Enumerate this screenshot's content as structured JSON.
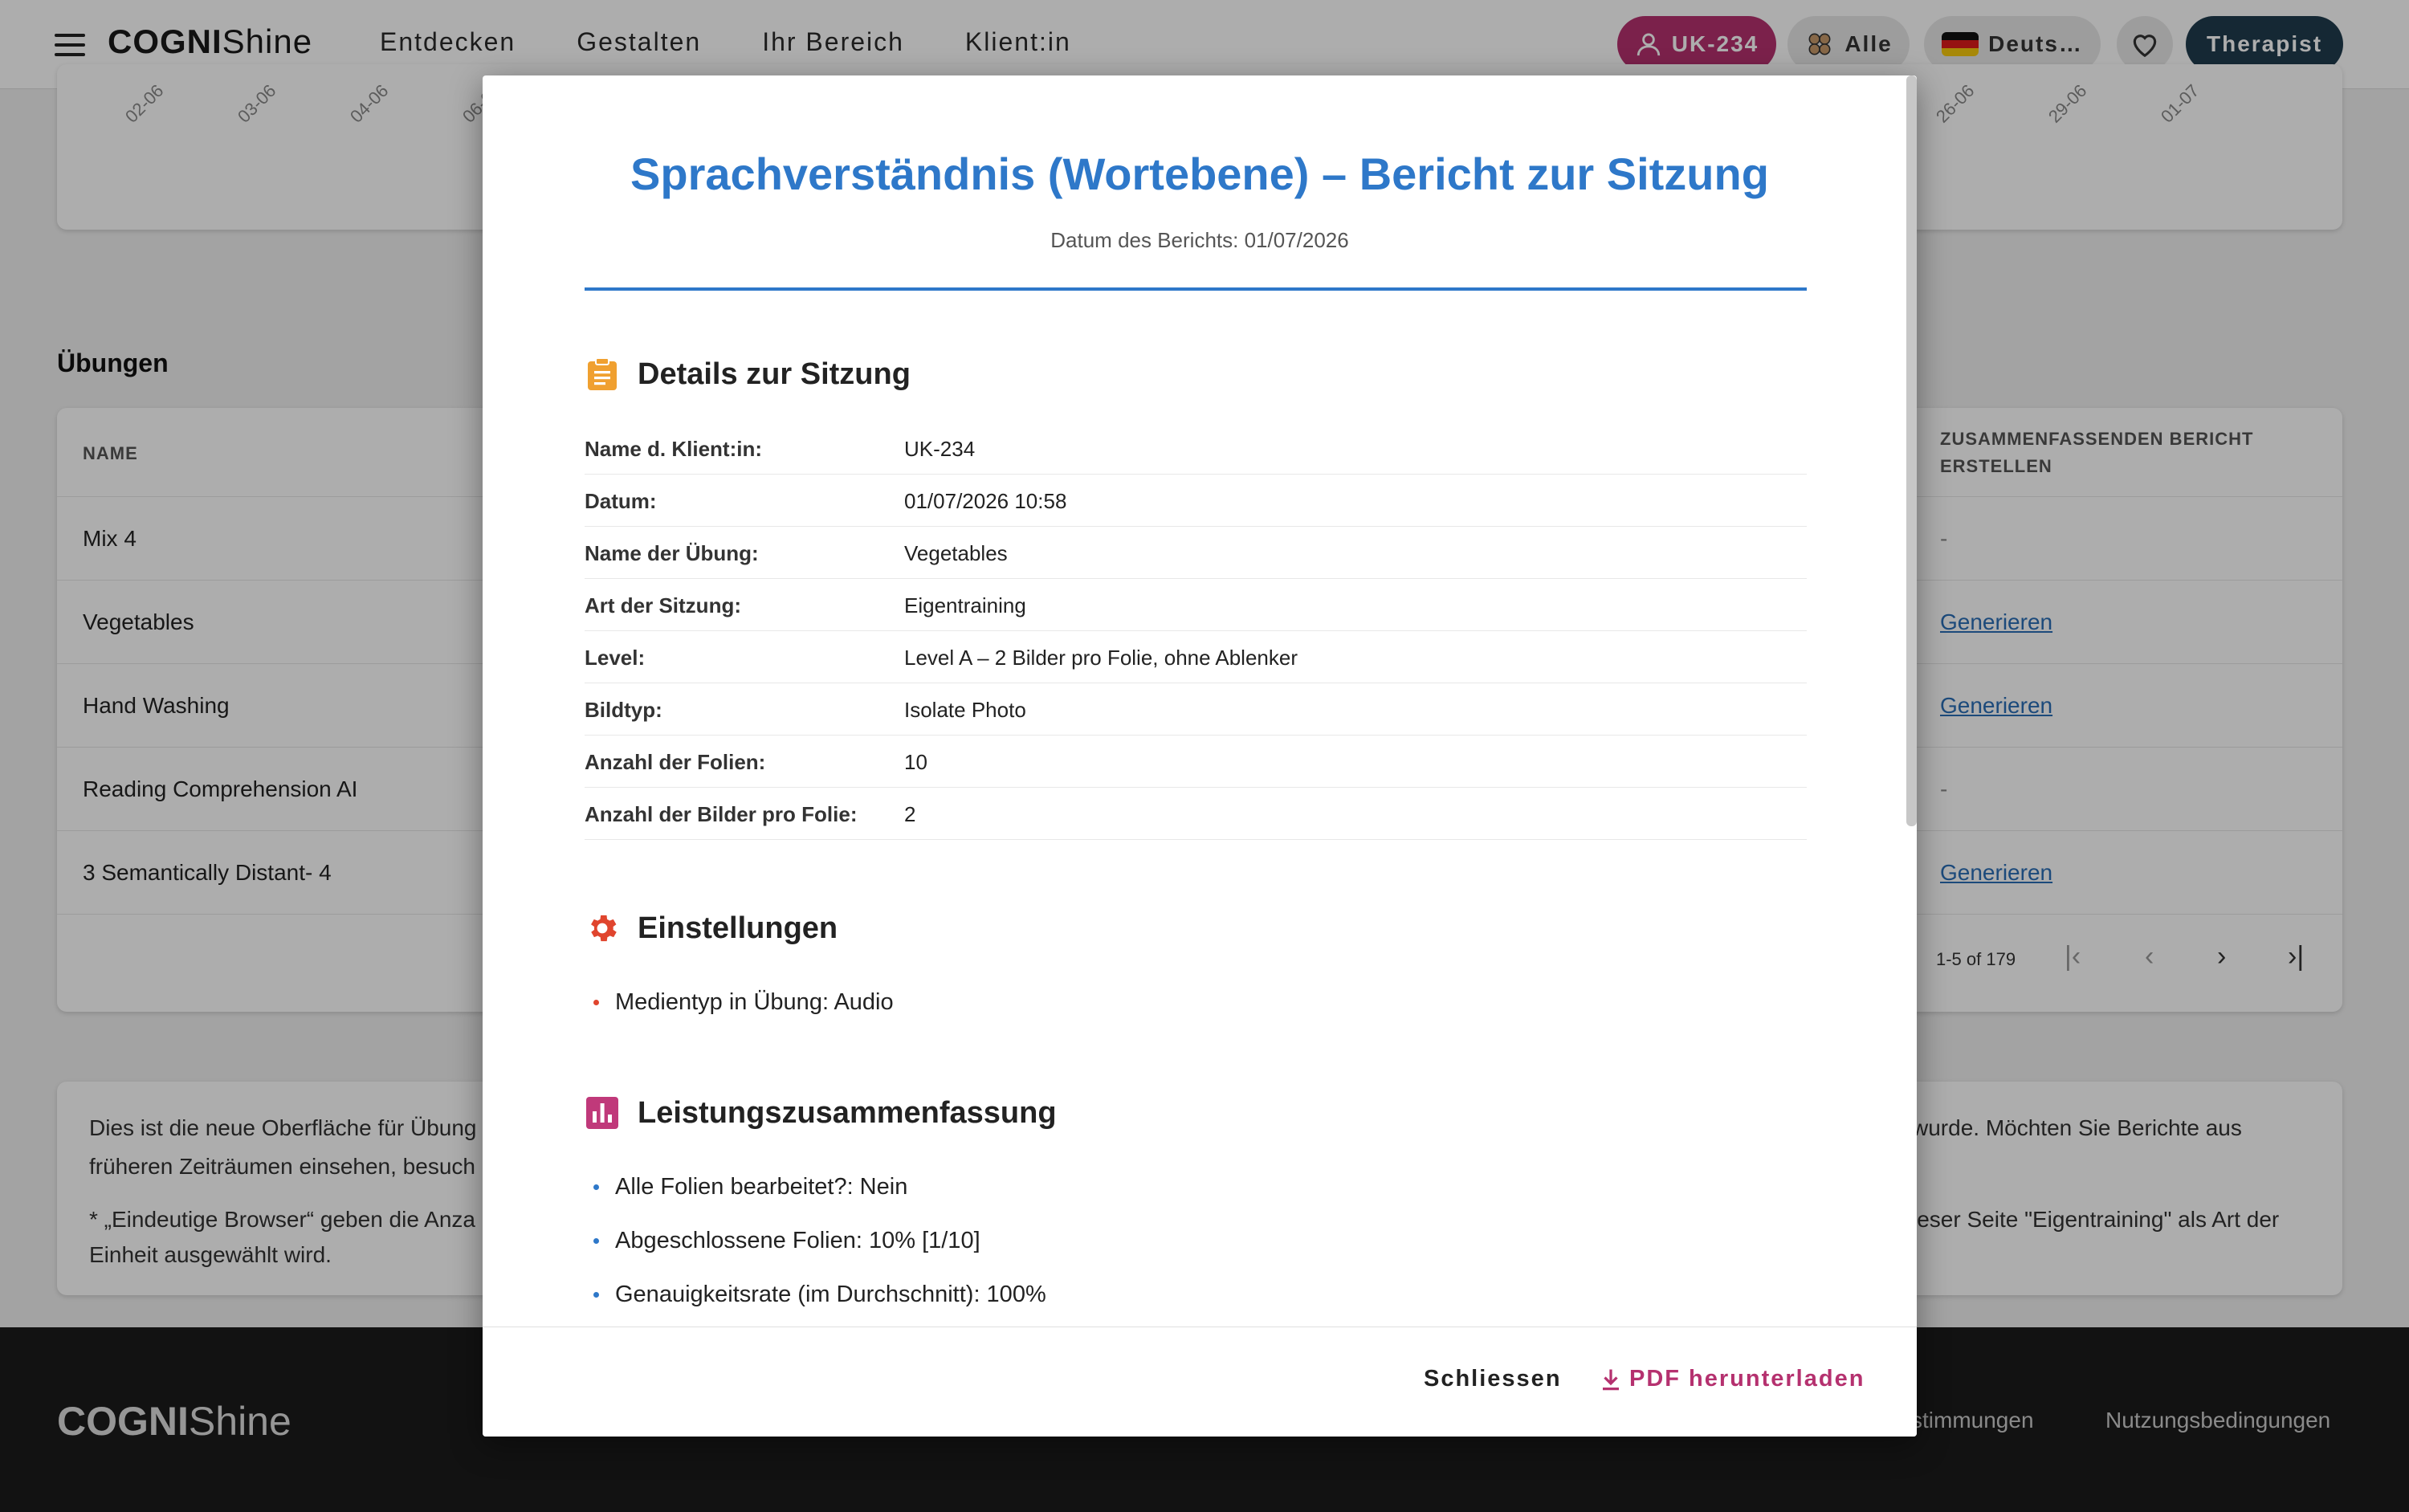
{
  "header": {
    "logo_bold": "COGNI",
    "logo_light": "Shine",
    "nav": [
      "Entdecken",
      "Gestalten",
      "Ihr Bereich",
      "Klient:in"
    ],
    "user_chip": "UK-234",
    "filter_chip": "Alle",
    "language_chip": "Deuts…",
    "role_chip": "Therapist"
  },
  "chart_ticks_left": [
    "02-06",
    "03-06",
    "04-06",
    "06-0"
  ],
  "chart_ticks_right": [
    "26-06",
    "29-06",
    "01-07"
  ],
  "exercises": {
    "title": "Übungen",
    "col_name": "NAME",
    "col_summary": "ZUSAMMENFASSENDEN BERICHT ERSTELLEN",
    "rows": [
      {
        "name": "Mix 4",
        "action": "-"
      },
      {
        "name": "Vegetables",
        "action": "Generieren"
      },
      {
        "name": "Hand Washing",
        "action": "Generieren"
      },
      {
        "name": "Reading Comprehension AI",
        "action": "-"
      },
      {
        "name": "3 Semantically Distant- 4",
        "action": "Generieren"
      }
    ],
    "pagination": "1-5 of 179"
  },
  "info": {
    "line1_left": "Dies ist die neue Oberfläche für Übung",
    "line1_right": "wurde. Möchten Sie Berichte aus",
    "line2_left": "früheren Zeiträumen einsehen, besuch",
    "line3_left": "* „Eindeutige Browser“ geben die Anza",
    "line3_right": "ieser Seite \"Eigentraining\" als Art der",
    "line4_left": "Einheit ausgewählt wird."
  },
  "footer": {
    "logo_bold": "COGNI",
    "logo_light": "Shine",
    "links": [
      "stimmungen",
      "Nutzungsbedingungen"
    ]
  },
  "modal": {
    "title": "Sprachverständnis (Wortebene) – Bericht zur Sitzung",
    "report_date": "Datum des Berichts: 01/07/2026",
    "details_heading": "Details zur Sitzung",
    "details": [
      {
        "label": "Name d. Klient:in:",
        "value": "UK-234"
      },
      {
        "label": "Datum:",
        "value": "01/07/2026 10:58"
      },
      {
        "label": "Name der Übung:",
        "value": "Vegetables"
      },
      {
        "label": "Art der Sitzung:",
        "value": "Eigentraining"
      },
      {
        "label": "Level:",
        "value": "Level A – 2 Bilder pro Folie, ohne Ablenker"
      },
      {
        "label": "Bildtyp:",
        "value": "Isolate Photo"
      },
      {
        "label": "Anzahl der Folien:",
        "value": "10"
      },
      {
        "label": "Anzahl der Bilder pro Folie:",
        "value": "2"
      }
    ],
    "settings_heading": "Einstellungen",
    "settings": [
      "Medientyp in Übung: Audio"
    ],
    "performance_heading": "Leistungszusammenfassung",
    "performance": [
      "Alle Folien bearbeitet?: Nein",
      "Abgeschlossene Folien: 10% [1/10]",
      "Genauigkeitsrate (im Durchschnitt): 100%"
    ],
    "close_label": "Schliessen",
    "pdf_label": "PDF herunterladen"
  },
  "colors": {
    "accent_blue": "#2e78c9",
    "brand_pink": "#b5316f",
    "details_icon": "#f0a030",
    "settings_icon": "#e0452e",
    "performance_icon": "#c0397a"
  },
  "icons": {
    "details": "clipboard-icon",
    "settings": "gear-icon",
    "performance": "bar-chart-icon",
    "download": "download-icon"
  }
}
